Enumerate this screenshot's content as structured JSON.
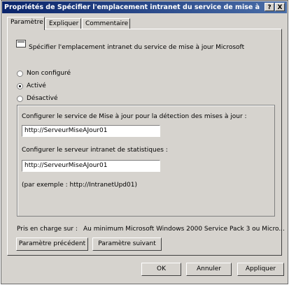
{
  "window": {
    "title": "Propriétés de Spécifier l'emplacement intranet du service de mise à jour...",
    "help_button": "?",
    "close_button": "X"
  },
  "tabs": [
    {
      "label": "Paramètre",
      "active": true
    },
    {
      "label": "Expliquer",
      "active": false
    },
    {
      "label": "Commentaire",
      "active": false
    }
  ],
  "policy": {
    "icon": "policy-icon",
    "name": "Spécifier l'emplacement intranet du service de mise à jour Microsoft"
  },
  "options": {
    "not_configured": "Non configuré",
    "enabled": "Activé",
    "disabled": "Désactivé",
    "selected": "enabled"
  },
  "settings": {
    "update_service_label": "Configurer le service de Mise à jour pour la détection des mises à jour :",
    "update_service_value": "http://ServeurMiseAJour01",
    "stats_server_label": "Configurer le serveur intranet de statistiques :",
    "stats_server_value": "http://ServeurMiseAJour01",
    "example": "(par exemple : http://IntranetUpd01)"
  },
  "supported": {
    "label": "Pris en charge sur :",
    "value": "Au minimum Microsoft Windows 2000 Service Pack 3 ou Micro..."
  },
  "nav": {
    "previous": "Paramètre précédent",
    "next": "Paramètre suivant"
  },
  "buttons": {
    "ok": "OK",
    "cancel": "Annuler",
    "apply": "Appliquer"
  }
}
